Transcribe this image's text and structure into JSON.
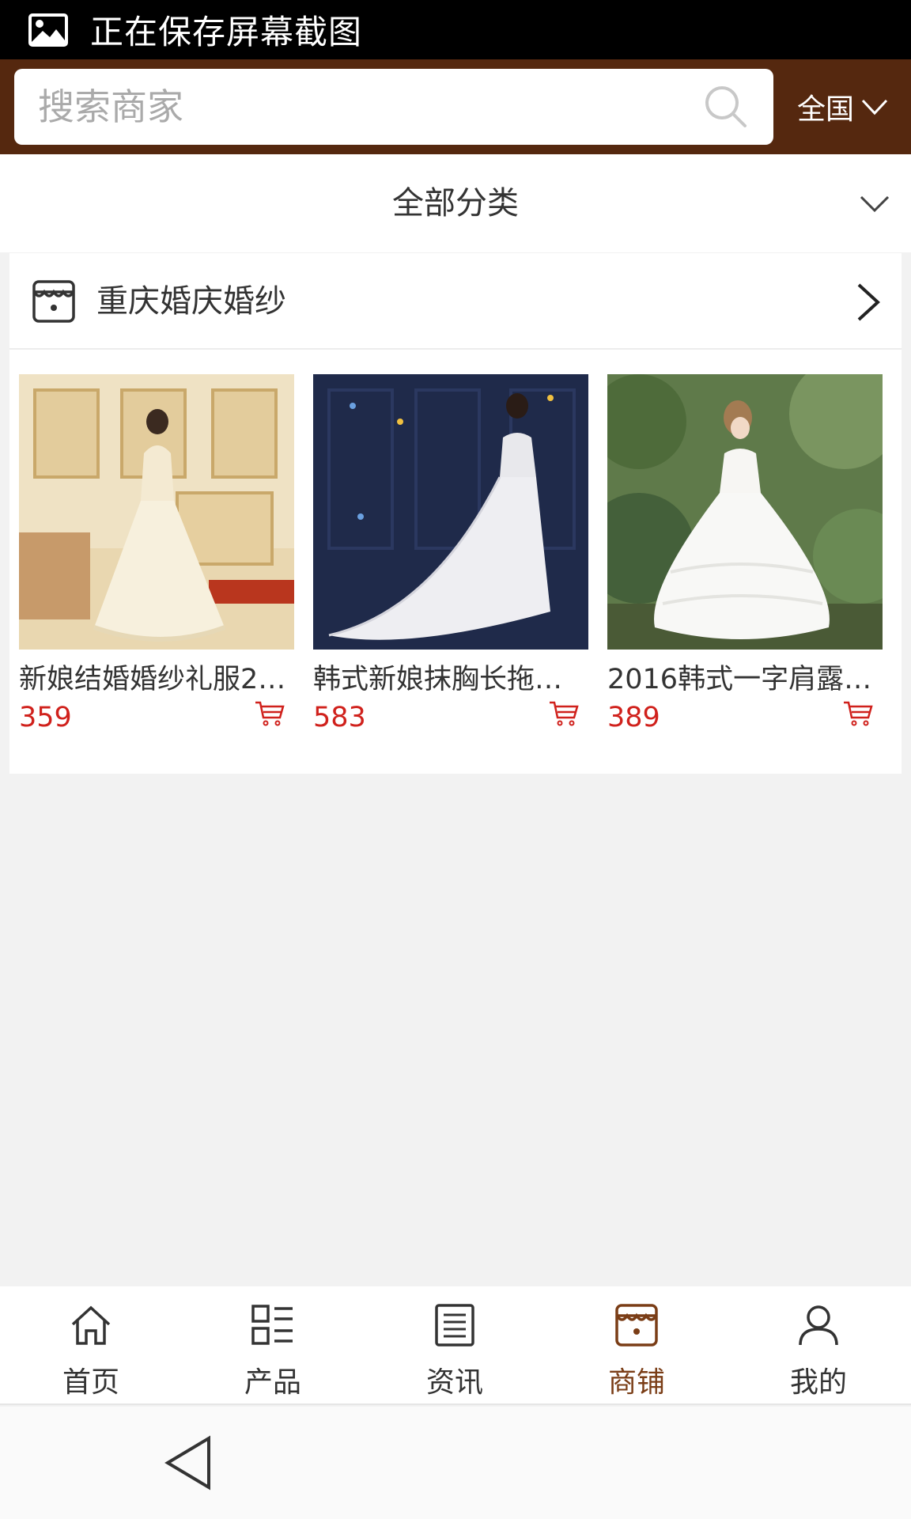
{
  "status_bar": {
    "text": "正在保存屏幕截图"
  },
  "header": {
    "search_placeholder": "搜索商家",
    "region": "全国",
    "colors": {
      "background": "#55280f",
      "search_bg": "#ffffff"
    }
  },
  "category": {
    "label": "全部分类"
  },
  "shop": {
    "name": "重庆婚庆婚纱",
    "products": [
      {
        "title": "新娘结婚婚纱礼服2…",
        "price": "359",
        "image": "wedding-dress-back-ivory-room"
      },
      {
        "title": "韩式新娘抹胸长拖…",
        "price": "583",
        "image": "wedding-dress-train-navy-wall"
      },
      {
        "title": "2016韩式一字肩露…",
        "price": "389",
        "image": "wedding-dress-ballgown-garden"
      }
    ],
    "price_color": "#d0211c"
  },
  "bottom_nav": {
    "items": [
      {
        "label": "首页",
        "icon": "home-icon"
      },
      {
        "label": "产品",
        "icon": "grid-list-icon"
      },
      {
        "label": "资讯",
        "icon": "news-icon"
      },
      {
        "label": "商铺",
        "icon": "store-icon",
        "active": true
      },
      {
        "label": "我的",
        "icon": "user-icon"
      }
    ],
    "active_color": "#7a3d16"
  },
  "system_nav": {
    "icon": "back-triangle-icon"
  }
}
